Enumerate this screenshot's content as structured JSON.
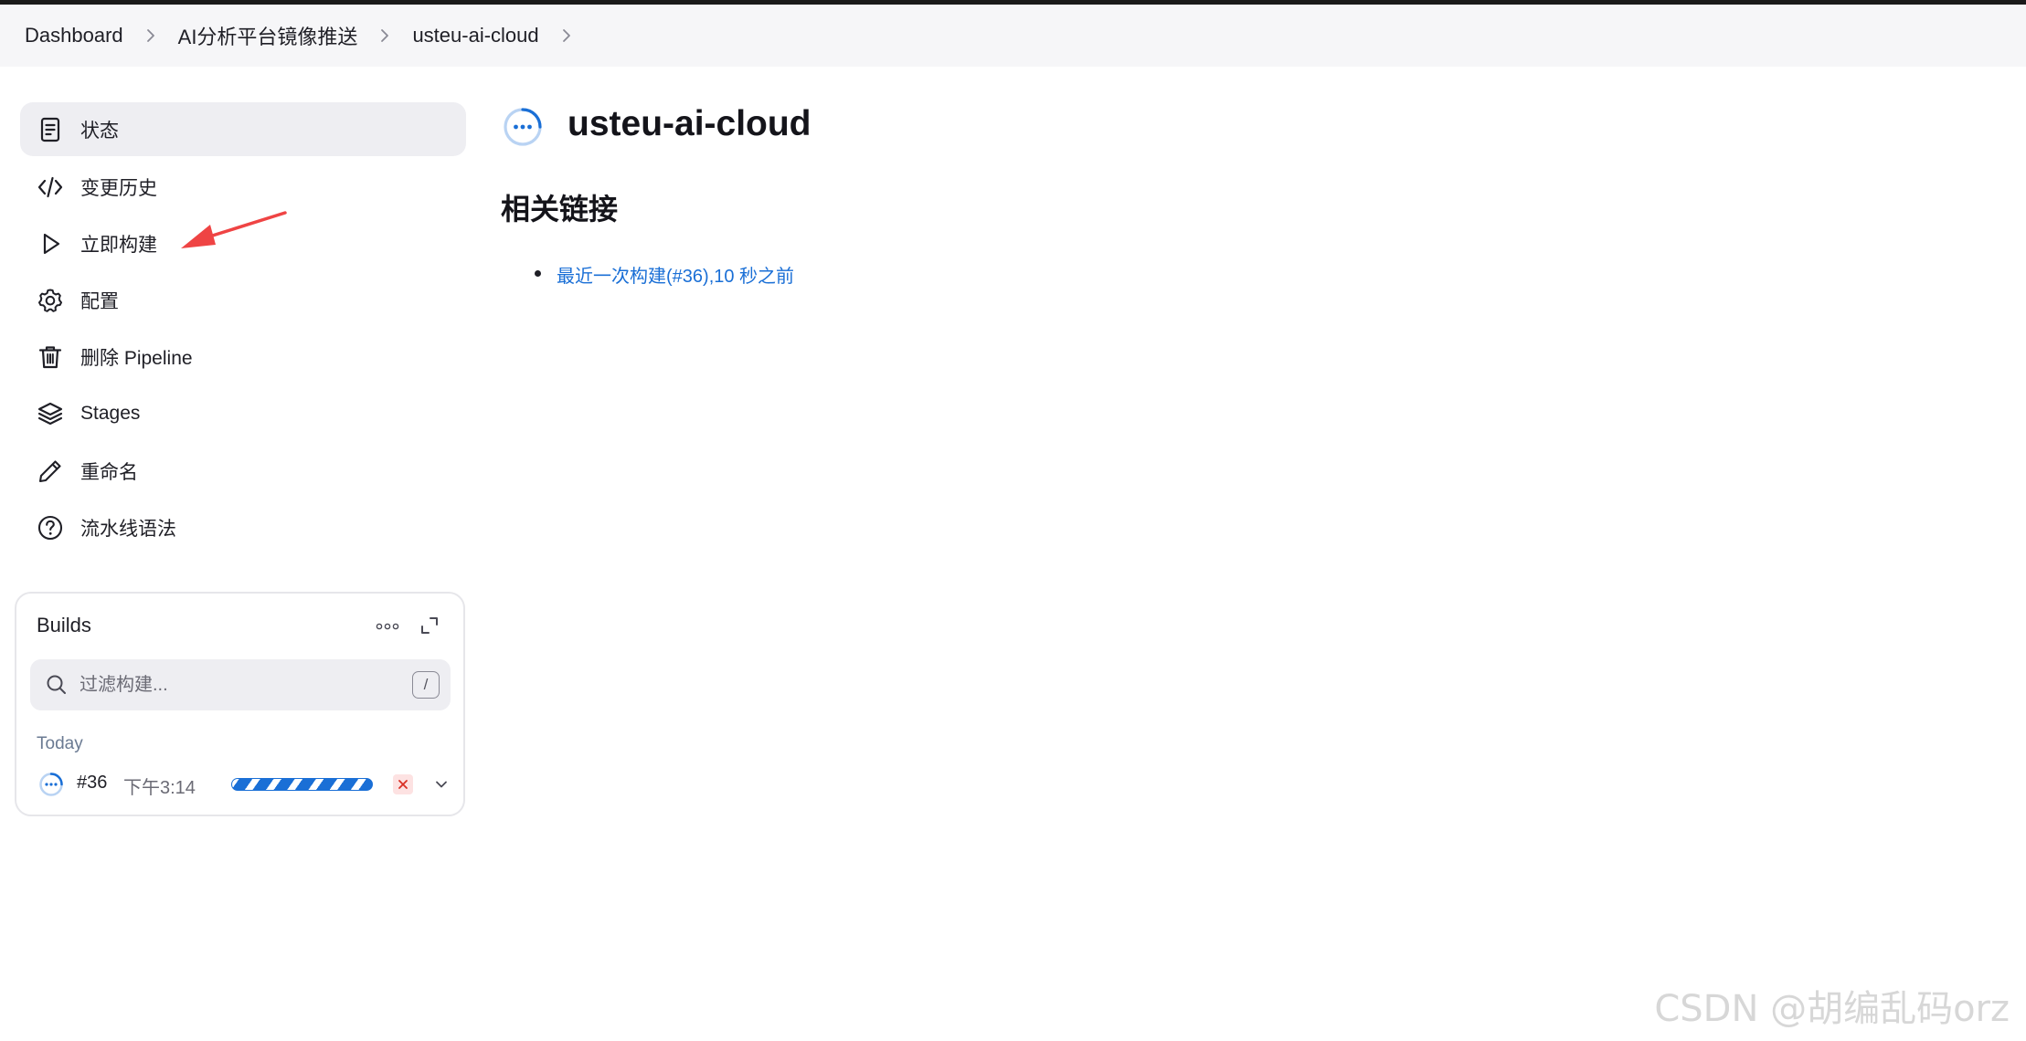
{
  "breadcrumb": [
    "Dashboard",
    "AI分析平台镜像推送",
    "usteu-ai-cloud"
  ],
  "sidebar": {
    "items": [
      {
        "label": "状态",
        "icon": "document-icon"
      },
      {
        "label": "变更历史",
        "icon": "code-icon"
      },
      {
        "label": "立即构建",
        "icon": "play-icon"
      },
      {
        "label": "配置",
        "icon": "gear-icon"
      },
      {
        "label": "删除 Pipeline",
        "icon": "trash-icon"
      },
      {
        "label": "Stages",
        "icon": "layers-icon"
      },
      {
        "label": "重命名",
        "icon": "pencil-icon"
      },
      {
        "label": "流水线语法",
        "icon": "help-icon"
      }
    ]
  },
  "builds": {
    "title": "Builds",
    "filter_placeholder": "过滤构建...",
    "shortcut_key": "/",
    "group_label": "Today",
    "rows": [
      {
        "number": "#36",
        "time": "下午3:14",
        "status": "running"
      }
    ]
  },
  "main": {
    "job_title": "usteu-ai-cloud",
    "section_title": "相关链接",
    "links": [
      "最近一次构建(#36),10 秒之前"
    ]
  },
  "watermark": "CSDN @胡编乱码orz",
  "colors": {
    "link": "#1a6fd6",
    "active_bg": "#eeeef2",
    "annotation": "#ef4444"
  }
}
